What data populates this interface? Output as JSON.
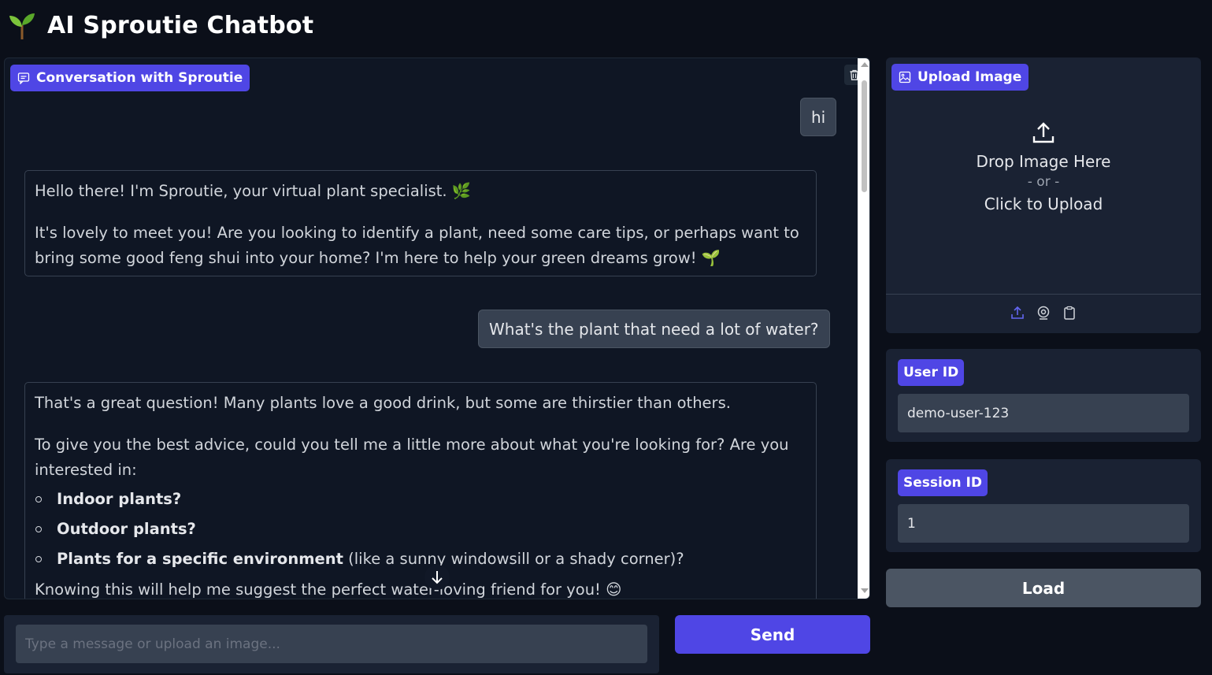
{
  "app": {
    "title": "AI Sproutie Chatbot"
  },
  "chat": {
    "label": "Conversation with Sproutie",
    "messages": [
      {
        "role": "user",
        "text": "hi"
      },
      {
        "role": "bot",
        "p1": "Hello there! I'm Sproutie, your virtual plant specialist. 🌿",
        "p2": "It's lovely to meet you! Are you looking to identify a plant, need some care tips, or perhaps want to bring some good feng shui into your home? I'm here to help your green dreams grow! 🌱"
      },
      {
        "role": "user",
        "text": "What's the plant that need a lot of water?"
      },
      {
        "role": "bot",
        "p1": "That's a great question! Many plants love a good drink, but some are thirstier than others.",
        "p2": "To give you the best advice, could you tell me a little more about what you're looking for? Are you interested in:",
        "items": [
          {
            "bold": "Indoor plants?",
            "rest": ""
          },
          {
            "bold": "Outdoor plants?",
            "rest": ""
          },
          {
            "bold": "Plants for a specific environment",
            "rest": " (like a sunny windowsill or a shady corner)?"
          }
        ],
        "p3": "Knowing this will help me suggest the perfect water-loving friend for you! 😊"
      }
    ]
  },
  "composer": {
    "placeholder": "Type a message or upload an image...",
    "send_label": "Send"
  },
  "upload": {
    "label": "Upload Image",
    "drop_text": "Drop Image Here",
    "or_text": "- or -",
    "click_text": "Click to Upload"
  },
  "user_id": {
    "label": "User ID",
    "value": "demo-user-123"
  },
  "session_id": {
    "label": "Session ID",
    "value": "1"
  },
  "load_label": "Load",
  "colors": {
    "accent": "#4f46e5",
    "background": "#0b0f19",
    "panel": "#1a2233"
  }
}
